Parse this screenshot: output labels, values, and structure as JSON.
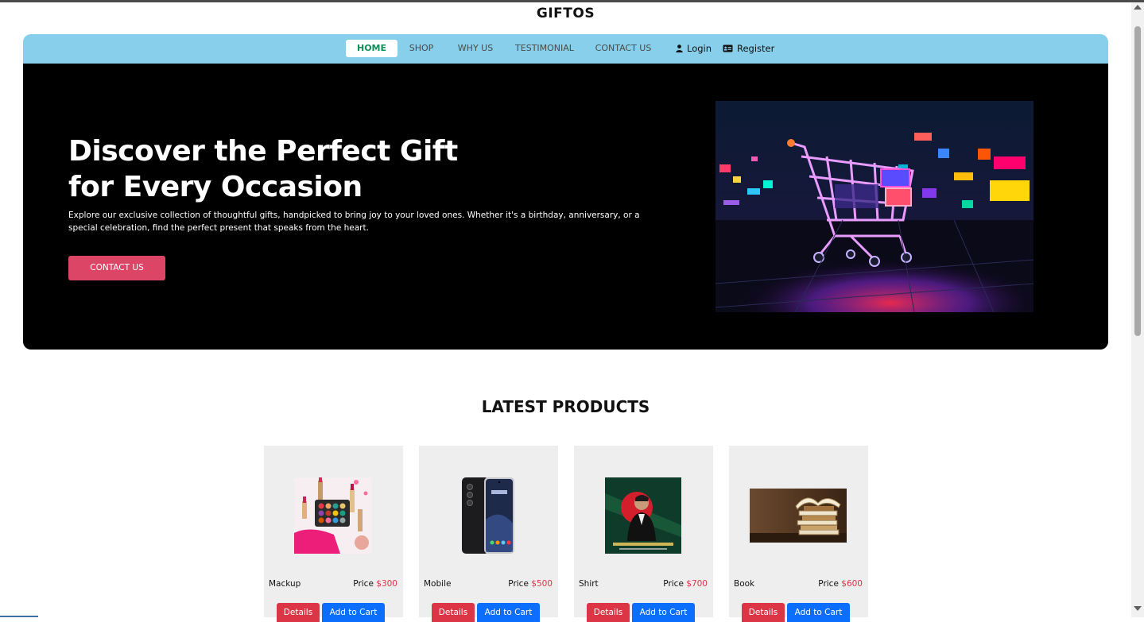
{
  "brand": "GIFTOS",
  "nav": {
    "home": "HOME",
    "shop": "SHOP",
    "why_us": "WHY US",
    "testimonial": "TESTIMONIAL",
    "contact": "CONTACT US",
    "login": "Login",
    "register": "Register"
  },
  "hero": {
    "title_line1": "Discover the Perfect Gift",
    "title_line2": "for Every Occasion",
    "text": "Explore our exclusive collection of thoughtful gifts, handpicked to bring joy to your loved ones. Whether it's a birthday, anniversary, or a special celebration, find the perfect present that speaks from the heart.",
    "button": "CONTACT US",
    "image_icon": "neon-shopping-cart-image"
  },
  "products": {
    "title": "LATEST PRODUCTS",
    "price_label": "Price",
    "details_label": "Details",
    "cart_label": "Add to Cart",
    "items": [
      {
        "name": "Mackup",
        "price": "$300",
        "icon": "makeup-image"
      },
      {
        "name": "Mobile",
        "price": "$500",
        "icon": "smartphone-image"
      },
      {
        "name": "Shirt",
        "price": "$700",
        "icon": "poster-image"
      },
      {
        "name": "Book",
        "price": "$600",
        "icon": "books-image"
      }
    ]
  },
  "colors": {
    "nav_bg": "#87cfeb",
    "active_nav_text": "#0d8f57",
    "hero_bg": "#000000",
    "hero_button": "#dc4566",
    "price_accent": "#dc3545",
    "details_button": "#dc3545",
    "cart_button": "#0b6efd",
    "card_bg": "#eeeeee"
  }
}
